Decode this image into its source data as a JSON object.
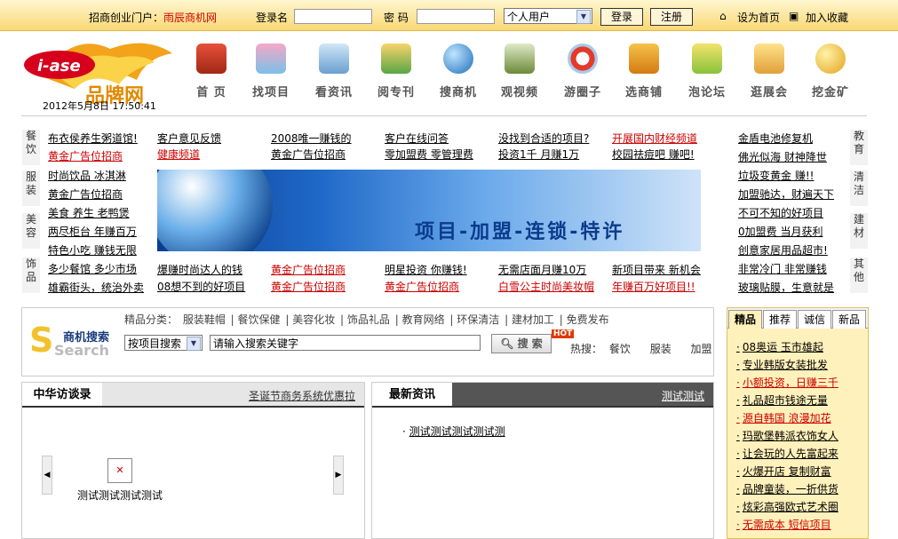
{
  "topbar": {
    "portal_label": "招商创业门户：",
    "portal_name": "雨辰商机网",
    "login_label": "登录名",
    "password_label": "密  码",
    "user_type": "个人用户",
    "login_button": "登录",
    "register_button": "注册",
    "set_homepage": "设为首页",
    "bookmark": "加入收藏"
  },
  "header": {
    "logo_text": "i-ase",
    "logo_cn": "品牌网",
    "datetime": "2012年5月8日  17:50:41",
    "nav": [
      {
        "label": "首 页",
        "icon": "home-icon"
      },
      {
        "label": "找项目",
        "icon": "project-icon"
      },
      {
        "label": "看资讯",
        "icon": "news-icon"
      },
      {
        "label": "阅专刊",
        "icon": "magazine-icon"
      },
      {
        "label": "搜商机",
        "icon": "globe-icon"
      },
      {
        "label": "观视频",
        "icon": "video-icon"
      },
      {
        "label": "游圈子",
        "icon": "circle-icon"
      },
      {
        "label": "选商铺",
        "icon": "shop-icon"
      },
      {
        "label": "泡论坛",
        "icon": "forum-icon"
      },
      {
        "label": "逛展会",
        "icon": "expo-icon"
      },
      {
        "label": "挖金矿",
        "icon": "gold-icon"
      }
    ]
  },
  "categories": {
    "left_tabs": [
      "餐饮",
      "服装",
      "美容",
      "饰品"
    ],
    "right_tabs": [
      "教育",
      "清洁",
      "建材",
      "其他"
    ],
    "col1": [
      "布衣侯养生粥道馆!",
      "黄金广告位招商",
      "时尚饮品 冰淇淋",
      "黄金广告位招商",
      "美食 养生 老鸭煲",
      "两尽柜台 年赚百万",
      "特色小吃 赚钱无限",
      "多少餐馆 多少市场",
      "雄霸街头，统治外卖"
    ],
    "top_row": [
      "客户意见反馈",
      "2008唯一赚钱的",
      "客户在线问答",
      "没找到合适的项目?",
      "开展国内财经频道"
    ],
    "top_row2": [
      "健康频道",
      "黄金广告位招商",
      "零加盟费 零管理费",
      "投资1千 月赚1万",
      "校园祛痘吧 赚吧!"
    ],
    "bottom_row": [
      "爆赚时尚达人的钱",
      "黄金广告位招商",
      "明星投资 你赚钱!",
      "无需店面月赚10万",
      "新项目带来 新机会"
    ],
    "bottom_row2": [
      "08想不到的好项目",
      "黄金广告位招商",
      "黄金广告位招商",
      "白雪公主时尚美妆帽",
      "年赚百万好项目!!"
    ],
    "col_right": [
      "金盾电池修复机",
      "佛光似海 财神降世",
      "垃圾变黄金 赚!!",
      "加盟驰达，财遍天下",
      "不可不知的好项目",
      "0加盟费 当月获利",
      "创意家居用品超市!",
      "非常冷门 非常赚钱",
      "玻璃贴膜，生意就是"
    ],
    "banner_text": "项目-加盟-连锁-特许"
  },
  "search": {
    "logo_top": "商机搜索",
    "logo_bottom": "Search",
    "cats_label": "精品分类：",
    "cats": [
      "服装鞋帽",
      "餐饮保健",
      "美容化妆",
      "饰品礼品",
      "教育网络",
      "环保清洁",
      "建材加工",
      "免费发布"
    ],
    "mode": "按项目搜索",
    "input_value": "请输入搜索关键字",
    "button": "搜 索",
    "hot_badge": "HOT",
    "hot_label": "热搜：",
    "hot_items": [
      "餐饮",
      "服装",
      "加盟"
    ]
  },
  "right_panel": {
    "tabs": [
      "精品",
      "推荐",
      "诚信",
      "新品"
    ],
    "items": [
      "08奥运 玉市雄起",
      "专业韩版女装批发",
      "小额投资，日赚三千",
      "礼品超市钱途无量",
      "源自韩国 浪漫加花",
      "玛歌堡韩派衣饰女人",
      "让会玩的人先富起来",
      "火爆开店 复制财富",
      "品牌童装，一折供货",
      "炫彩高强欧式艺术圈",
      "无需成本 短信项目"
    ]
  },
  "panel_left": {
    "title": "中华访谈录",
    "more": "圣诞节商务系统优惠拉",
    "caption": "测试测试测试测试"
  },
  "panel_mid": {
    "title": "最新资讯",
    "more": "测试测试",
    "item": "测试测试测试测试测"
  },
  "colors": {
    "accent": "#cc0000",
    "topbar": "#f9d875"
  }
}
